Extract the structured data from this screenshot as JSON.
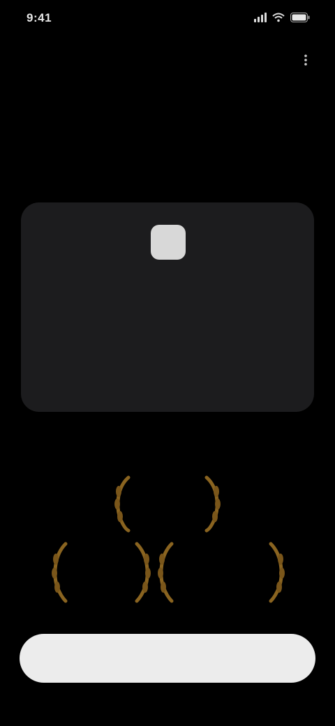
{
  "status_bar": {
    "time": "9:41",
    "icons": [
      "signal-icon",
      "wifi-icon",
      "battery-icon"
    ]
  },
  "header": {
    "back_label": "",
    "more_icon": "more-icon"
  },
  "title": {
    "text": "",
    "subtitle": ""
  },
  "card": {
    "badge_text": "",
    "heading": "",
    "body": "",
    "link_label": ""
  },
  "awards": [
    {
      "text": "",
      "icon": "laurel-icon"
    },
    {
      "text": "",
      "icon": "laurel-icon"
    },
    {
      "text": "",
      "icon": "laurel-icon"
    }
  ],
  "primary_button": {
    "label": ""
  },
  "colors": {
    "background": "#000000",
    "card": "#1c1c1e",
    "laurel": "#8a6420",
    "button": "#ececec"
  }
}
